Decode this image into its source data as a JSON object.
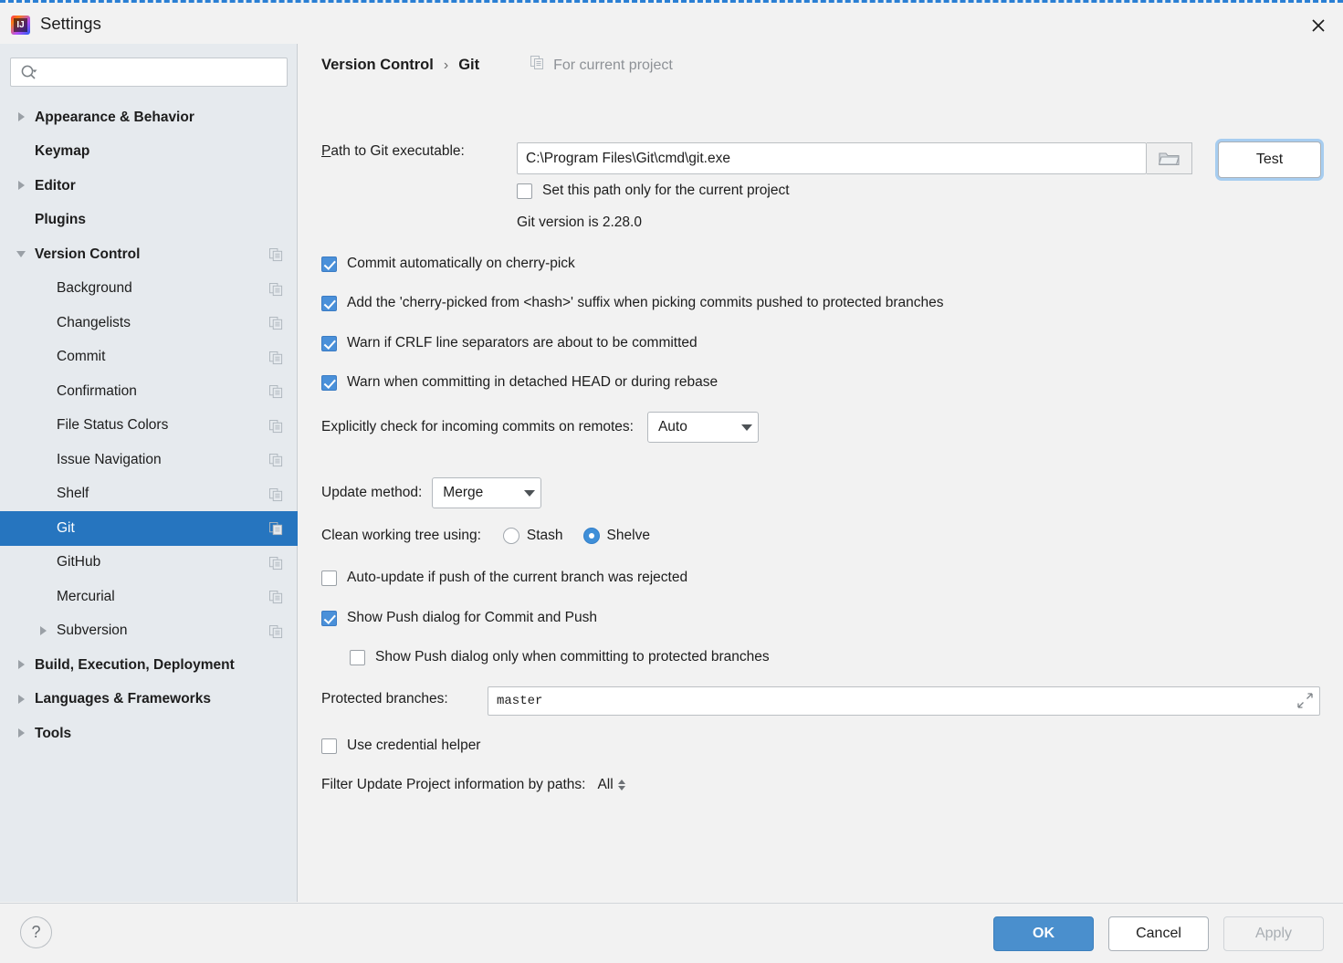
{
  "window": {
    "title": "Settings",
    "logo_icon": "intellij-idea-logo",
    "close_icon": "close-icon"
  },
  "sidebar": {
    "search": {
      "value": "",
      "placeholder": "",
      "icon": "search-icon"
    },
    "items": [
      {
        "label": "Appearance & Behavior",
        "indent": 0,
        "arrow": "right",
        "bold": true,
        "copy_icon": false,
        "selected": false
      },
      {
        "label": "Keymap",
        "indent": 0,
        "arrow": "none",
        "bold": true,
        "copy_icon": false,
        "selected": false
      },
      {
        "label": "Editor",
        "indent": 0,
        "arrow": "right",
        "bold": true,
        "copy_icon": false,
        "selected": false
      },
      {
        "label": "Plugins",
        "indent": 0,
        "arrow": "none",
        "bold": true,
        "copy_icon": false,
        "selected": false
      },
      {
        "label": "Version Control",
        "indent": 0,
        "arrow": "down",
        "bold": true,
        "copy_icon": true,
        "selected": false
      },
      {
        "label": "Background",
        "indent": 1,
        "arrow": "none",
        "bold": false,
        "copy_icon": true,
        "selected": false
      },
      {
        "label": "Changelists",
        "indent": 1,
        "arrow": "none",
        "bold": false,
        "copy_icon": true,
        "selected": false
      },
      {
        "label": "Commit",
        "indent": 1,
        "arrow": "none",
        "bold": false,
        "copy_icon": true,
        "selected": false
      },
      {
        "label": "Confirmation",
        "indent": 1,
        "arrow": "none",
        "bold": false,
        "copy_icon": true,
        "selected": false
      },
      {
        "label": "File Status Colors",
        "indent": 1,
        "arrow": "none",
        "bold": false,
        "copy_icon": true,
        "selected": false
      },
      {
        "label": "Issue Navigation",
        "indent": 1,
        "arrow": "none",
        "bold": false,
        "copy_icon": true,
        "selected": false
      },
      {
        "label": "Shelf",
        "indent": 1,
        "arrow": "none",
        "bold": false,
        "copy_icon": true,
        "selected": false
      },
      {
        "label": "Git",
        "indent": 1,
        "arrow": "none",
        "bold": false,
        "copy_icon": true,
        "selected": true
      },
      {
        "label": "GitHub",
        "indent": 1,
        "arrow": "none",
        "bold": false,
        "copy_icon": true,
        "selected": false
      },
      {
        "label": "Mercurial",
        "indent": 1,
        "arrow": "none",
        "bold": false,
        "copy_icon": true,
        "selected": false
      },
      {
        "label": "Subversion",
        "indent": 1,
        "arrow": "right",
        "bold": false,
        "copy_icon": true,
        "selected": false
      },
      {
        "label": "Build, Execution, Deployment",
        "indent": 0,
        "arrow": "right",
        "bold": true,
        "copy_icon": false,
        "selected": false
      },
      {
        "label": "Languages & Frameworks",
        "indent": 0,
        "arrow": "right",
        "bold": true,
        "copy_icon": false,
        "selected": false
      },
      {
        "label": "Tools",
        "indent": 0,
        "arrow": "right",
        "bold": true,
        "copy_icon": false,
        "selected": false
      }
    ]
  },
  "main": {
    "breadcrumb": {
      "parent": "Version Control",
      "separator": "›",
      "current": "Git"
    },
    "scope": {
      "label": "For current project",
      "icon": "copy-scope-icon"
    },
    "git_path": {
      "label_prefix": "P",
      "label_rest": "ath to Git executable:",
      "value": "C:\\Program Files\\Git\\cmd\\git.exe",
      "browse_icon": "folder-icon",
      "test_button": "Test"
    },
    "set_path_current_project": {
      "label": "Set this path only for the current project",
      "checked": false
    },
    "git_version": "Git version is 2.28.0",
    "checkboxes": [
      {
        "label": "Commit automatically on cherry-pick",
        "checked": true
      },
      {
        "label": "Add the 'cherry-picked from <hash>' suffix when picking commits pushed to protected branches",
        "checked": true
      },
      {
        "label": "Warn if CRLF line separators are about to be committed",
        "checked": true
      },
      {
        "label": "Warn when committing in detached HEAD or during rebase",
        "checked": true
      }
    ],
    "incoming_commits": {
      "label": "Explicitly check for incoming commits on remotes:",
      "value": "Auto"
    },
    "update_method": {
      "label": "Update method:",
      "value": "Merge"
    },
    "clean_working_tree": {
      "label": "Clean working tree using:",
      "options": [
        {
          "label": "Stash",
          "selected": false
        },
        {
          "label": "Shelve",
          "selected": true
        }
      ]
    },
    "auto_update": {
      "label": "Auto-update if push of the current branch was rejected",
      "checked": false
    },
    "show_push_dialog": {
      "label": "Show Push dialog for Commit and Push",
      "checked": true
    },
    "show_push_dialog_protected": {
      "label": "Show Push dialog only when committing to protected branches",
      "checked": false
    },
    "protected_branches": {
      "label": "Protected branches:",
      "value": "master",
      "expand_icon": "expand-icon"
    },
    "use_credential_helper": {
      "label": "Use credential helper",
      "checked": false
    },
    "filter_update": {
      "label": "Filter Update Project information by paths:",
      "value": "All"
    }
  },
  "footer": {
    "help_icon": "?",
    "ok": "OK",
    "cancel": "Cancel",
    "apply": "Apply"
  },
  "colors": {
    "accent": "#2675bf",
    "primary_button": "#4a8fcd",
    "highlight_box": "#ec1c24",
    "sidebar_bg": "#e6eaee",
    "focus_ring": "#a7cdf0"
  }
}
